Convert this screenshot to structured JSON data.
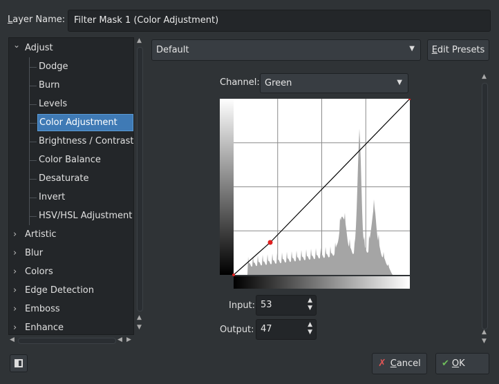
{
  "layer_name": {
    "label_prefix": "L",
    "label_rest": "ayer Name:",
    "value": "Filter Mask 1 (Color Adjustment)"
  },
  "tree": {
    "items": [
      {
        "label": "Adjust",
        "expanded": true,
        "level": 0
      },
      {
        "label": "Dodge",
        "level": 1
      },
      {
        "label": "Burn",
        "level": 1
      },
      {
        "label": "Levels",
        "level": 1
      },
      {
        "label": "Color Adjustment",
        "level": 1,
        "selected": true
      },
      {
        "label": "Brightness / Contrast",
        "level": 1
      },
      {
        "label": "Color Balance",
        "level": 1
      },
      {
        "label": "Desaturate",
        "level": 1
      },
      {
        "label": "Invert",
        "level": 1
      },
      {
        "label": "HSV/HSL Adjustment",
        "level": 1
      },
      {
        "label": "Artistic",
        "level": 0
      },
      {
        "label": "Blur",
        "level": 0
      },
      {
        "label": "Colors",
        "level": 0
      },
      {
        "label": "Edge Detection",
        "level": 0
      },
      {
        "label": "Emboss",
        "level": 0
      },
      {
        "label": "Enhance",
        "level": 0
      }
    ]
  },
  "preset": {
    "value": "Default",
    "edit_prefix": "E",
    "edit_rest": "dit Presets"
  },
  "channel": {
    "label": "Channel:",
    "value": "Green"
  },
  "curve": {
    "points": [
      [
        0,
        0
      ],
      [
        53,
        47
      ],
      [
        255,
        255
      ]
    ],
    "input_label": "Input:",
    "input_value": "53",
    "output_label": "Output:",
    "output_value": "47"
  },
  "buttons": {
    "cancel_prefix": "C",
    "cancel_rest": "ancel",
    "ok_prefix": "O",
    "ok_rest": "K"
  },
  "colors": {
    "selection": "#3f7ab5",
    "curve_point": "#e02020",
    "histogram": "#a5a5a5"
  }
}
